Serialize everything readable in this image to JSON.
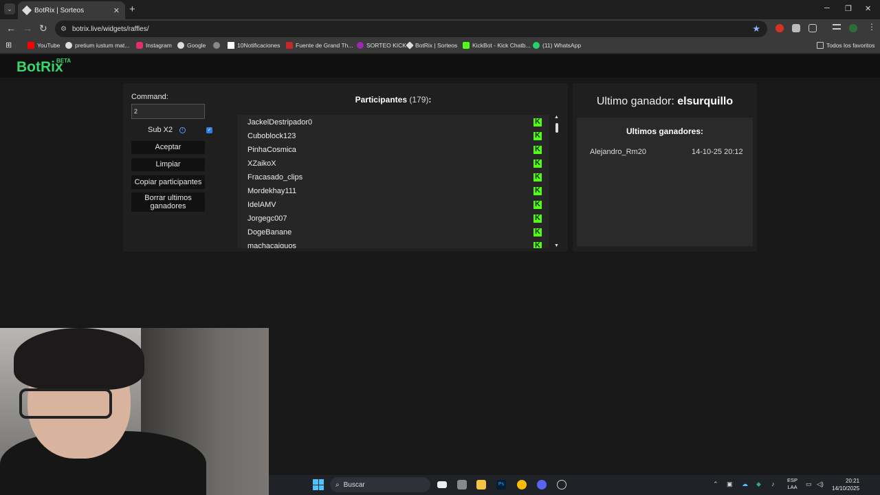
{
  "browser": {
    "tab_title": "BotRix | Sorteos",
    "url": "botrix.live/widgets/raffles/",
    "bookmarks": [
      "YouTube",
      "pretium iustum mat...",
      "Instagram",
      "Google",
      "10Notificaciones",
      "Fuente de Grand Th...",
      "SORTEO KICK",
      "BotRix | Sorteos",
      "KickBot - Kick Chatb...",
      "(11) WhatsApp"
    ],
    "all_bookmarks": "Todos los favoritos"
  },
  "app": {
    "logo": "BotRix",
    "logo_badge": "BETA"
  },
  "controls": {
    "command_label": "Command:",
    "command_value": "2",
    "sub_label": "Sub X2",
    "sub_checked": true,
    "accept_label": "Aceptar",
    "clear_label": "Limpiar",
    "copy_label": "Copiar participantes",
    "delete_label": "Borrar ultimos ganadores"
  },
  "participants": {
    "title": "Participantes",
    "count": "(179)",
    "colon": ":",
    "list": [
      "JackelDestripador0",
      "Cuboblock123",
      "PinhaCosmica",
      "XZaikoX",
      "Fracasado_clips",
      "Mordekhay111",
      "IdelAMV",
      "Jorgegc007",
      "DogeBanane",
      "machacaiguos"
    ]
  },
  "winners": {
    "last_label": "Ultimo ganador:",
    "last_name": "elsurquillo",
    "recent_title": "Ultimos ganadores:",
    "recent": [
      {
        "name": "Alejandro_Rm20",
        "date": "14-10-25 20:12"
      }
    ]
  },
  "taskbar": {
    "search_placeholder": "Buscar",
    "lang_top": "ESP",
    "lang_bottom": "LAA",
    "time": "20:21",
    "date": "14/10/2025"
  },
  "colors": {
    "accent_green": "#3bd66a",
    "kick_green": "#53fc18",
    "checkbox_blue": "#2f7fe8"
  }
}
